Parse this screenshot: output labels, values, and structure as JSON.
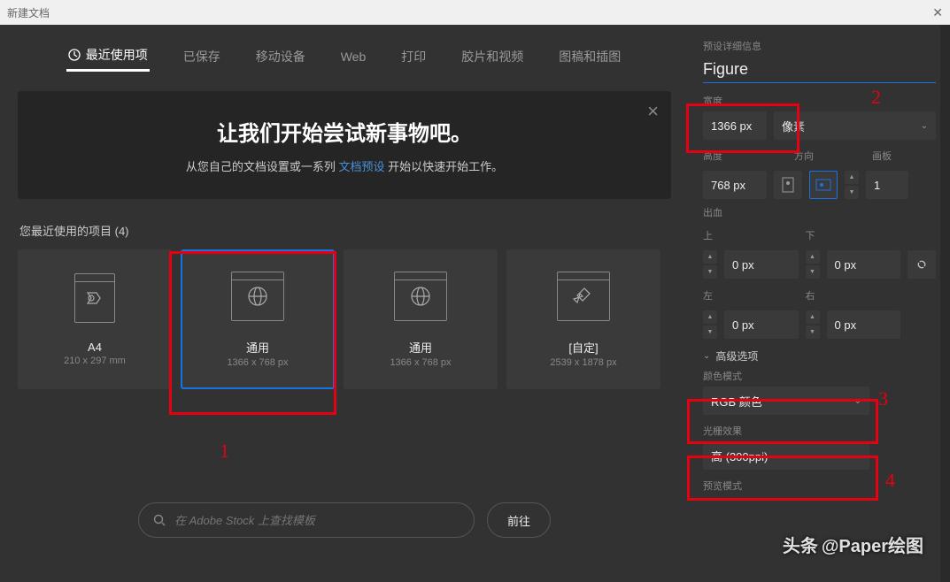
{
  "window": {
    "title": "新建文档"
  },
  "tabs": [
    "最近使用项",
    "已保存",
    "移动设备",
    "Web",
    "打印",
    "胶片和视频",
    "图稿和插图"
  ],
  "hero": {
    "title": "让我们开始尝试新事物吧。",
    "subtitle_prefix": "从您自己的文档设置或一系列 ",
    "subtitle_link": "文档预设",
    "subtitle_suffix": " 开始以快速开始工作。"
  },
  "recent": {
    "label": "您最近使用的项目  (4)",
    "items": [
      {
        "name": "A4",
        "dims": "210 x 297 mm",
        "icon": "doc"
      },
      {
        "name": "通用",
        "dims": "1366 x 768 px",
        "icon": "web"
      },
      {
        "name": "通用",
        "dims": "1366 x 768 px",
        "icon": "web"
      },
      {
        "name": "[自定]",
        "dims": "2539 x 1878 px",
        "icon": "custom"
      }
    ]
  },
  "search": {
    "placeholder": "在 Adobe Stock 上查找模板",
    "go": "前往"
  },
  "details": {
    "section": "预设详细信息",
    "name": "Figure",
    "width_label": "宽度",
    "width": "1366 px",
    "unit": "像素",
    "height_label": "高度",
    "height": "768 px",
    "orient_label": "方向",
    "artboard_label": "画板",
    "artboards": "1",
    "bleed_label": "出血",
    "top": "上",
    "bottom": "下",
    "left": "左",
    "right": "右",
    "bleed_top": "0 px",
    "bleed_bottom": "0 px",
    "bleed_left": "0 px",
    "bleed_right": "0 px",
    "advanced": "高级选项",
    "color_mode_label": "颜色模式",
    "color_mode": "RGB 颜色",
    "raster_label": "光栅效果",
    "raster": "高 (300ppi)",
    "preview_label": "预览模式"
  },
  "annotations": {
    "a1": "1",
    "a2": "2",
    "a3": "3",
    "a4": "4"
  },
  "watermark": {
    "brand": "头条 ",
    "handle": "@Paper绘图",
    "alt": "Paper绘图"
  }
}
